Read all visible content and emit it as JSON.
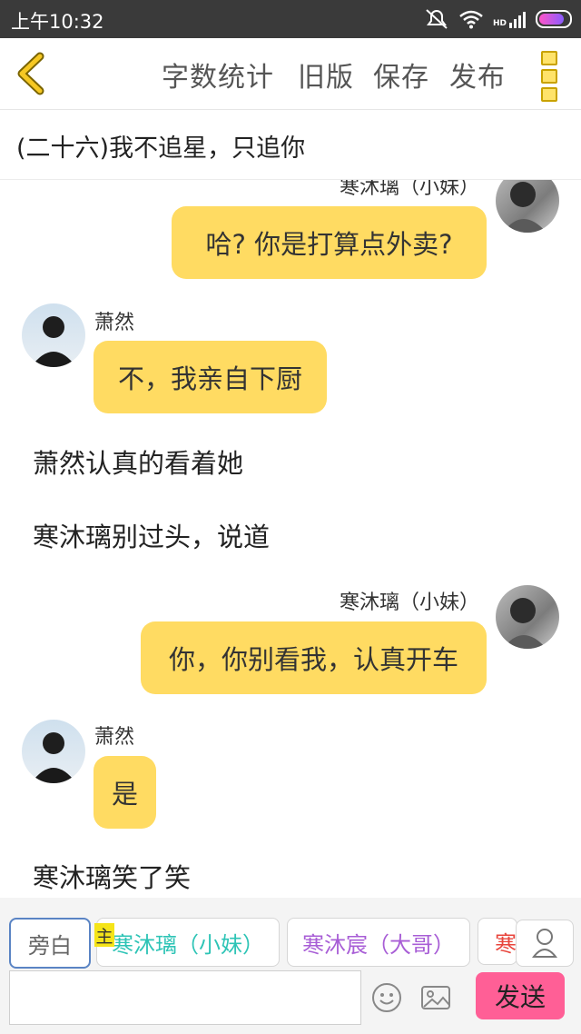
{
  "status_bar": {
    "time": "上午10:32",
    "network_label": "HD"
  },
  "app_bar": {
    "buttons": [
      "字数统计",
      "旧版",
      "保存",
      "发布"
    ]
  },
  "chapter_title": "(二十六)我不追星，只追你",
  "messages": [
    {
      "speaker": "寒沐璃（小妹）",
      "text": "哈? 你是打算点外卖?"
    },
    {
      "speaker": "萧然",
      "text": "不，我亲自下厨"
    },
    {
      "narration": "萧然认真的看着她"
    },
    {
      "narration": "寒沐璃别过头，说道"
    },
    {
      "speaker": "寒沐璃（小妹）",
      "text": "你，你别看我，认真开车"
    },
    {
      "speaker": "萧然",
      "text": "是"
    },
    {
      "narration": "寒沐璃笑了笑"
    }
  ],
  "roles": [
    {
      "label": "旁白",
      "color": "#666666"
    },
    {
      "badge": "主",
      "label": "寒沐璃（小妹）",
      "color": "#2ec4b6"
    },
    {
      "label": "寒沐宸（大哥）",
      "color": "#a85ed6"
    },
    {
      "label": "寒",
      "color": "#e8453c"
    }
  ],
  "input": {
    "placeholder": "",
    "send_label": "发送"
  },
  "colors": {
    "bubble": "#ffdb62",
    "send": "#ff5f96",
    "accent_yellow": "#f5c400"
  }
}
